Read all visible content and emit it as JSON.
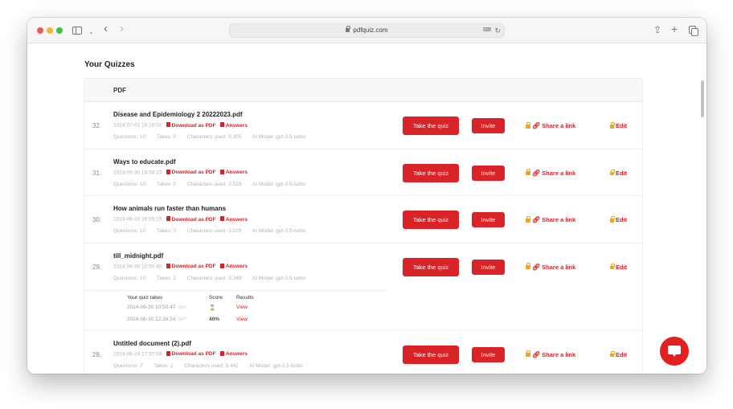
{
  "browser": {
    "url": "pdfquiz.com",
    "icons": {
      "sidebar": "sidebar-icon",
      "back": "‹",
      "forward": "›",
      "chevron": "⌄",
      "share": "⇪",
      "new_tab": "+",
      "reload": "↻",
      "translate": "⌨"
    }
  },
  "page": {
    "title": "Your Quizzes",
    "table_header": "PDF"
  },
  "actions": {
    "take_quiz": "Take the quiz",
    "invite": "Invite",
    "share_link": "Share a link",
    "edit": "Edit",
    "download_pdf": "Download as PDF",
    "answers": "Answers",
    "link_glyph": "🔗︎"
  },
  "quizzes": [
    {
      "number": "32.",
      "title": "Disease and Epidemiology 2 20222023.pdf",
      "date": "2024-07-01 16:16:02",
      "questions": "Questions: 10",
      "takes": "Takes: 0",
      "characters": "Characters used: 9,305",
      "model": "AI Model: gpt-3.5-turbo"
    },
    {
      "number": "31.",
      "title": "Ways to educate.pdf",
      "date": "2024-06-30 16:58:23",
      "questions": "Questions: 10",
      "takes": "Takes: 0",
      "characters": "Characters used: 3,529",
      "model": "AI Model: gpt-3.5-turbo"
    },
    {
      "number": "30.",
      "title": "How animals run faster than humans",
      "date": "2024-06-30 16:55:15",
      "questions": "Questions: 10",
      "takes": "Takes: 0",
      "characters": "Characters used: 3,529",
      "model": "AI Model: gpt-3.5-turbo"
    },
    {
      "number": "29.",
      "title": "till_midnight.pdf",
      "date": "2024-06-30 10:50:40",
      "questions": "Questions: 10",
      "takes": "Takes: 2",
      "characters": "Characters used: 3,348",
      "model": "AI Model: gpt-3.5-turbo",
      "quiz_takes": {
        "headers": [
          "Your quiz takes",
          "Score",
          "Results"
        ],
        "rows": [
          {
            "date": "2024-06-30 10:50:47",
            "tz": "GMT",
            "score": "⌛",
            "result": "View"
          },
          {
            "date": "2024-06-30 12:26:24",
            "tz": "GMT",
            "score": "40%",
            "result": "View"
          }
        ]
      }
    },
    {
      "number": "28.",
      "title": "Untitled document (2).pdf",
      "date": "2024-06-29 17:37:59",
      "questions": "Questions: 7",
      "takes": "Takes: 2",
      "characters": "Characters used: 9,442",
      "model": "AI Model: gpt-3.5-turbo"
    }
  ],
  "colors": {
    "accent": "#da2327",
    "lock": "#f0a51b",
    "chat": "#e41f1f"
  }
}
